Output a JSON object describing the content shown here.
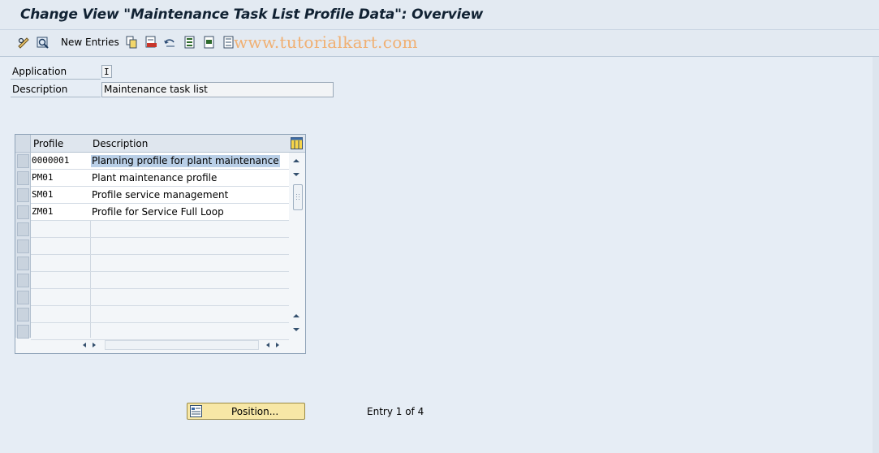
{
  "window": {
    "title": "Change View \"Maintenance Task List Profile Data\": Overview"
  },
  "toolbar": {
    "items": [
      {
        "icon": "edit-glasses-icon"
      },
      {
        "icon": "display-change-icon"
      },
      {
        "label": "New Entries"
      },
      {
        "icon": "copy-icon"
      },
      {
        "icon": "delete-icon"
      },
      {
        "icon": "undo-change-icon"
      },
      {
        "icon": "select-all-icon"
      },
      {
        "icon": "select-block-icon"
      },
      {
        "icon": "deselect-all-icon"
      }
    ],
    "watermark": "www.tutorialkart.com"
  },
  "header_fields": {
    "application": {
      "label": "Application",
      "value": "I"
    },
    "description": {
      "label": "Description",
      "value": "Maintenance task list"
    }
  },
  "table": {
    "columns": [
      "Profile",
      "Description"
    ],
    "settings_icon": "table-settings-icon",
    "rows": [
      {
        "profile": "0000001",
        "description": "Planning profile for plant maintenance",
        "selected": true
      },
      {
        "profile": "PM01",
        "description": "Plant maintenance profile"
      },
      {
        "profile": "SM01",
        "description": "Profile service management"
      },
      {
        "profile": "ZM01",
        "description": "Profile for Service Full Loop"
      }
    ],
    "empty_rows": 7
  },
  "footer": {
    "position_button": "Position...",
    "entry_info": "Entry 1 of 4"
  },
  "colors": {
    "background": "#e6edf5",
    "title": "#112233",
    "button": "#f7e7a6",
    "selection": "#b9cfe7",
    "watermark": "#f0b073"
  }
}
